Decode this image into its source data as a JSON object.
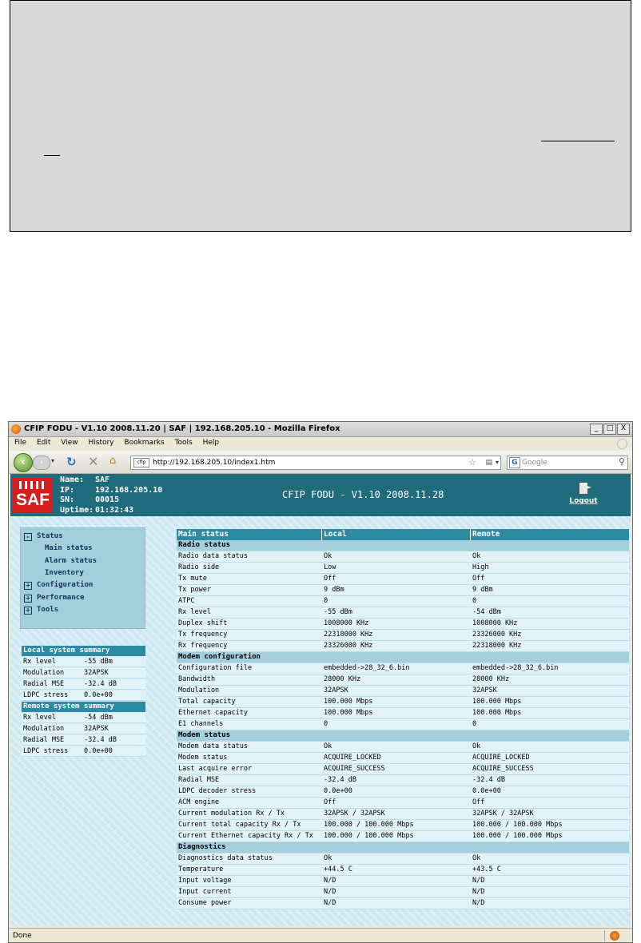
{
  "window": {
    "title": "CFIP FODU - V1.10 2008.11.20 | SAF | 192.168.205.10 - Mozilla Firefox",
    "minimize": "_",
    "maximize": "□",
    "close": "X"
  },
  "menubar": [
    "File",
    "Edit",
    "View",
    "History",
    "Bookmarks",
    "Tools",
    "Help"
  ],
  "nav": {
    "url": "http://192.168.205.10/index1.htm",
    "favicon_text": "cfip",
    "search_placeholder": "Google"
  },
  "header": {
    "logo": "SAF",
    "name_label": "Name:",
    "name_value": "SAF",
    "ip_label": "IP:",
    "ip_value": "192.168.205.10",
    "sn_label": "SN:",
    "sn_value": "00015",
    "uptime_label": "Uptime:",
    "uptime_value": "01:32:43",
    "title": "CFIP FODU - V1.10 2008.11.28",
    "logout": "Logout"
  },
  "left_menu": {
    "status": "Status",
    "main_status": "Main status",
    "alarm_status": "Alarm status",
    "inventory": "Inventory",
    "configuration": "Configuration",
    "performance": "Performance",
    "tools": "Tools"
  },
  "local_summary": {
    "title": "Local system summary",
    "rows": [
      {
        "k": "Rx level",
        "v": "-55 dBm"
      },
      {
        "k": "Modulation",
        "v": "32APSK"
      },
      {
        "k": "Radial MSE",
        "v": "-32.4 dB"
      },
      {
        "k": "LDPC stress",
        "v": "0.0e+00"
      }
    ]
  },
  "remote_summary": {
    "title": "Remote system summary",
    "rows": [
      {
        "k": "Rx level",
        "v": "-54 dBm"
      },
      {
        "k": "Modulation",
        "v": "32APSK"
      },
      {
        "k": "Radial MSE",
        "v": "-32.4 dB"
      },
      {
        "k": "LDPC stress",
        "v": "0.0e+00"
      }
    ]
  },
  "main_table": {
    "headers": [
      "Main status",
      "Local",
      "Remote"
    ],
    "rows": [
      {
        "section": "Radio status"
      },
      {
        "c": [
          "Radio data status",
          "Ok",
          "Ok"
        ]
      },
      {
        "c": [
          "Radio side",
          "Low",
          "High"
        ]
      },
      {
        "c": [
          "Tx mute",
          "Off",
          "Off"
        ]
      },
      {
        "c": [
          "Tx power",
          "9 dBm",
          "9 dBm"
        ]
      },
      {
        "c": [
          "ATPC",
          "0",
          "0"
        ]
      },
      {
        "c": [
          "Rx level",
          "-55 dBm",
          "-54 dBm"
        ]
      },
      {
        "c": [
          "Duplex shift",
          "1008000 KHz",
          "1008000 KHz"
        ]
      },
      {
        "c": [
          "Tx frequency",
          "22318000 KHz",
          "23326000 KHz"
        ]
      },
      {
        "c": [
          "Rx frequency",
          "23326000 KHz",
          "22318000 KHz"
        ]
      },
      {
        "section": "Modem configuration"
      },
      {
        "c": [
          "Configuration file",
          "embedded->28_32_6.bin",
          "embedded->28_32_6.bin"
        ]
      },
      {
        "c": [
          "Bandwidth",
          "28000 KHz",
          "28000 KHz"
        ]
      },
      {
        "c": [
          "Modulation",
          "32APSK",
          "32APSK"
        ]
      },
      {
        "c": [
          "Total capacity",
          "100.000 Mbps",
          "100.000 Mbps"
        ]
      },
      {
        "c": [
          "Ethernet capacity",
          "100.000 Mbps",
          "100.000 Mbps"
        ]
      },
      {
        "c": [
          "E1 channels",
          "0",
          "0"
        ]
      },
      {
        "section": "Modem status"
      },
      {
        "c": [
          "Modem data status",
          "Ok",
          "Ok"
        ]
      },
      {
        "c": [
          "Modem status",
          "ACQUIRE_LOCKED",
          "ACQUIRE_LOCKED"
        ]
      },
      {
        "c": [
          "Last acquire error",
          "ACQUIRE_SUCCESS",
          "ACQUIRE_SUCCESS"
        ]
      },
      {
        "c": [
          "Radial MSE",
          "-32.4 dB",
          "-32.4 dB"
        ]
      },
      {
        "c": [
          "LDPC decoder stress",
          "0.0e+00",
          "0.0e+00"
        ]
      },
      {
        "c": [
          "ACM engine",
          "Off",
          "Off"
        ]
      },
      {
        "c": [
          "Current modulation Rx / Tx",
          "32APSK / 32APSK",
          "32APSK / 32APSK"
        ]
      },
      {
        "c": [
          "Current total capacity Rx / Tx",
          "100.000 / 100.000 Mbps",
          "100.000 / 100.000 Mbps"
        ]
      },
      {
        "c": [
          "Current Ethernet capacity Rx / Tx",
          "100.000 / 100.000 Mbps",
          "100.000 / 100.000 Mbps"
        ]
      },
      {
        "section": "Diagnostics"
      },
      {
        "c": [
          "Diagnostics data status",
          "Ok",
          "Ok"
        ]
      },
      {
        "c": [
          "Temperature",
          "+44.5 C",
          "+43.5 C"
        ]
      },
      {
        "c": [
          "Input voltage",
          "N/D",
          "N/D"
        ]
      },
      {
        "c": [
          "Input current",
          "N/D",
          "N/D"
        ]
      },
      {
        "c": [
          "Consume power",
          "N/D",
          "N/D"
        ]
      }
    ]
  },
  "statusbar": {
    "text": "Done"
  }
}
